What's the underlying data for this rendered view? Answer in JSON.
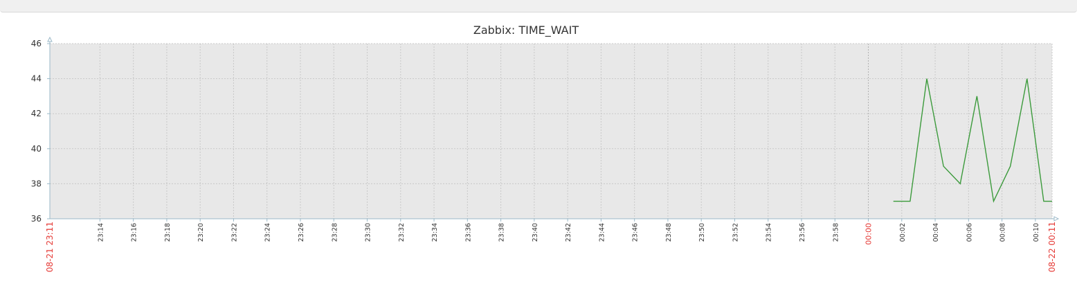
{
  "chart_data": {
    "type": "line",
    "title": "Zabbix: TIME_WAIT",
    "ylim": [
      36,
      46
    ],
    "yticks": [
      "36",
      "38",
      "40",
      "42",
      "44",
      "46"
    ],
    "x_start_label": "08-21 23:11",
    "x_end_label": "08-22 00:11",
    "x_tick_labels": [
      "23:14",
      "23:16",
      "23:18",
      "23:20",
      "23:22",
      "23:24",
      "23:26",
      "23:28",
      "23:30",
      "23:32",
      "23:34",
      "23:36",
      "23:38",
      "23:40",
      "23:42",
      "23:44",
      "23:46",
      "23:48",
      "23:50",
      "23:52",
      "23:54",
      "23:56",
      "23:58",
      "00:00",
      "00:02",
      "00:04",
      "00:06",
      "00:08",
      "00:10"
    ],
    "highlight_tick": "00:00",
    "grid": true,
    "series": [
      {
        "color": "#3b9a3b",
        "points": [
          {
            "t": "00:01:30",
            "v": 37
          },
          {
            "t": "00:02:30",
            "v": 37
          },
          {
            "t": "00:03:30",
            "v": 44
          },
          {
            "t": "00:04:30",
            "v": 39
          },
          {
            "t": "00:05:30",
            "v": 38
          },
          {
            "t": "00:06:30",
            "v": 43
          },
          {
            "t": "00:07:30",
            "v": 37
          },
          {
            "t": "00:08:30",
            "v": 39
          },
          {
            "t": "00:09:30",
            "v": 44
          },
          {
            "t": "00:10:30",
            "v": 37
          },
          {
            "t": "00:11:00",
            "v": 37
          }
        ]
      }
    ],
    "colors": {
      "plot_background": "#e8e8e8",
      "grid": "#c8c8c8",
      "axis": "#9ab8c8",
      "tick_text": "#333333",
      "highlight_text": "#e53935"
    }
  }
}
